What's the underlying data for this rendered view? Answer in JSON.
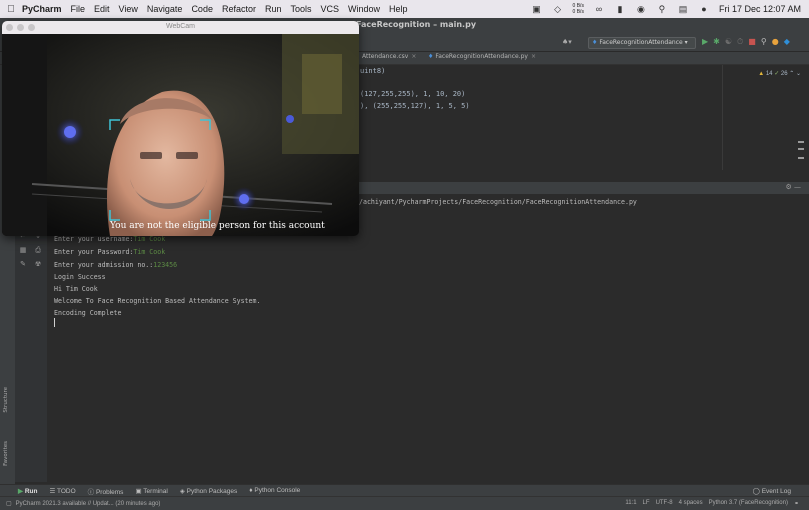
{
  "menubar": {
    "app": "PyCharm",
    "items": [
      "File",
      "Edit",
      "View",
      "Navigate",
      "Code",
      "Refactor",
      "Run",
      "Tools",
      "VCS",
      "Window",
      "Help"
    ],
    "net_up": "0 B/s",
    "net_down": "0 B/s",
    "datetime": "Fri 17 Dec  12:07 AM"
  },
  "ide": {
    "window_title": "FaceRecognition – main.py",
    "run_config": "FaceRecognitionAttendance",
    "tabs": [
      {
        "label": "Attendance.csv"
      },
      {
        "label": "FaceRecognitionAttendance.py"
      }
    ],
    "inspections": {
      "warnings": "14",
      "ok": "26"
    }
  },
  "editor": {
    "lines": [
      {
        "segments": [
          {
            "t": "uint8)",
            "c": ""
          }
        ]
      },
      {
        "segments": [
          {
            "t": "(127,255,255), 1, 10, 20)",
            "c": ""
          }
        ]
      },
      {
        "segments": [
          {
            "t": "), (255,255,127), 1, 5, 5)",
            "c": ""
          }
        ]
      }
    ]
  },
  "console": {
    "path": "/achiyant/PycharmProjects/FaceRecognition/FaceRecognitionAttendance.py",
    "lines": [
      {
        "prompt": "Enter your username:",
        "input": "Tim Cook"
      },
      {
        "prompt": "Enter your Password:",
        "input": "Tim Cook"
      },
      {
        "prompt": "Enter your admission no.:",
        "input": "123456"
      },
      {
        "prompt": "Login Success",
        "input": ""
      },
      {
        "prompt": "Hi Tim Cook",
        "input": ""
      },
      {
        "prompt": "Welcome To Face Recognition Based Attendance System.",
        "input": ""
      },
      {
        "prompt": "Encoding Complete",
        "input": ""
      }
    ]
  },
  "left_strip": {
    "structure": "Structure",
    "favorites": "Favorites"
  },
  "tool_windows": {
    "run": "Run",
    "todo": "TODO",
    "problems": "Problems",
    "terminal": "Terminal",
    "python_packages": "Python Packages",
    "python_console": "Python Console",
    "event_log": "Event Log"
  },
  "status": {
    "message": "PyCharm 2021.3 available // Updat... (20 minutes ago)",
    "position": "11:1",
    "line_sep": "LF",
    "encoding": "UTF-8",
    "indent": "4 spaces",
    "interpreter": "Python 3.7 (FaceRecognition)"
  },
  "webcam": {
    "title": "WebCam",
    "caption": "You are not the eligible person for this account"
  },
  "colors": {
    "ide_bg": "#2b2b2b",
    "panel": "#3c3f41",
    "input_text": "#5c8a44",
    "face_box": "#3fc3d6"
  }
}
